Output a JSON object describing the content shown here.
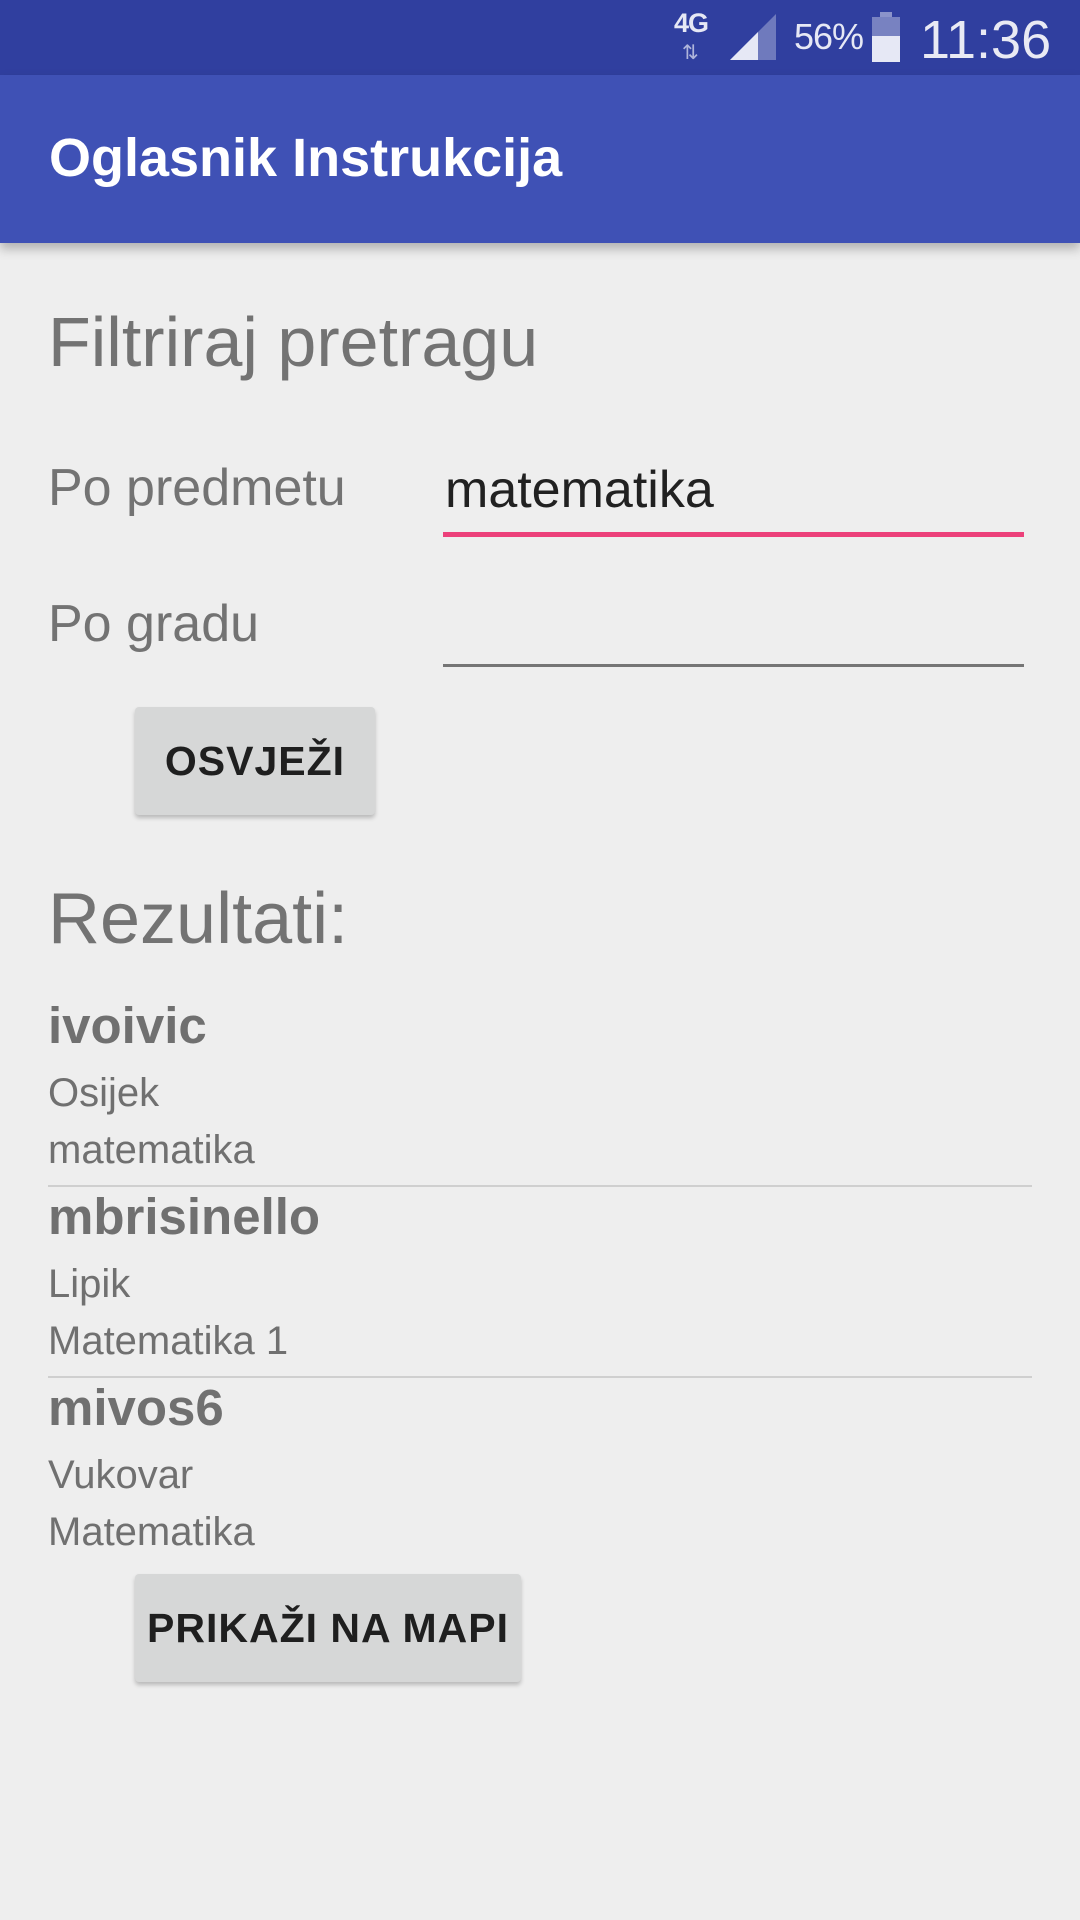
{
  "status_bar": {
    "network": "4G",
    "network_arrows": "⇅",
    "battery_percent": "56%",
    "time": "11:36"
  },
  "app_bar": {
    "title": "Oglasnik Instrukcija"
  },
  "filter": {
    "heading": "Filtriraj pretragu",
    "subject_label": "Po predmetu",
    "subject_value": "matematika",
    "city_label": "Po gradu",
    "city_value": "",
    "refresh_button": "OSVJEŽI"
  },
  "results": {
    "heading": "Rezultati:",
    "items": [
      {
        "name": "ivoivic",
        "city": "Osijek",
        "subject": "matematika"
      },
      {
        "name": "mbrisinello",
        "city": "Lipik",
        "subject": "Matematika 1"
      },
      {
        "name": "mivos6",
        "city": "Vukovar",
        "subject": "Matematika"
      }
    ],
    "map_button": "PRIKAŽI NA MAPI"
  },
  "colors": {
    "status_bar": "#303f9f",
    "app_bar": "#3f51b5",
    "accent": "#ec407a",
    "background": "#eeeeee"
  }
}
